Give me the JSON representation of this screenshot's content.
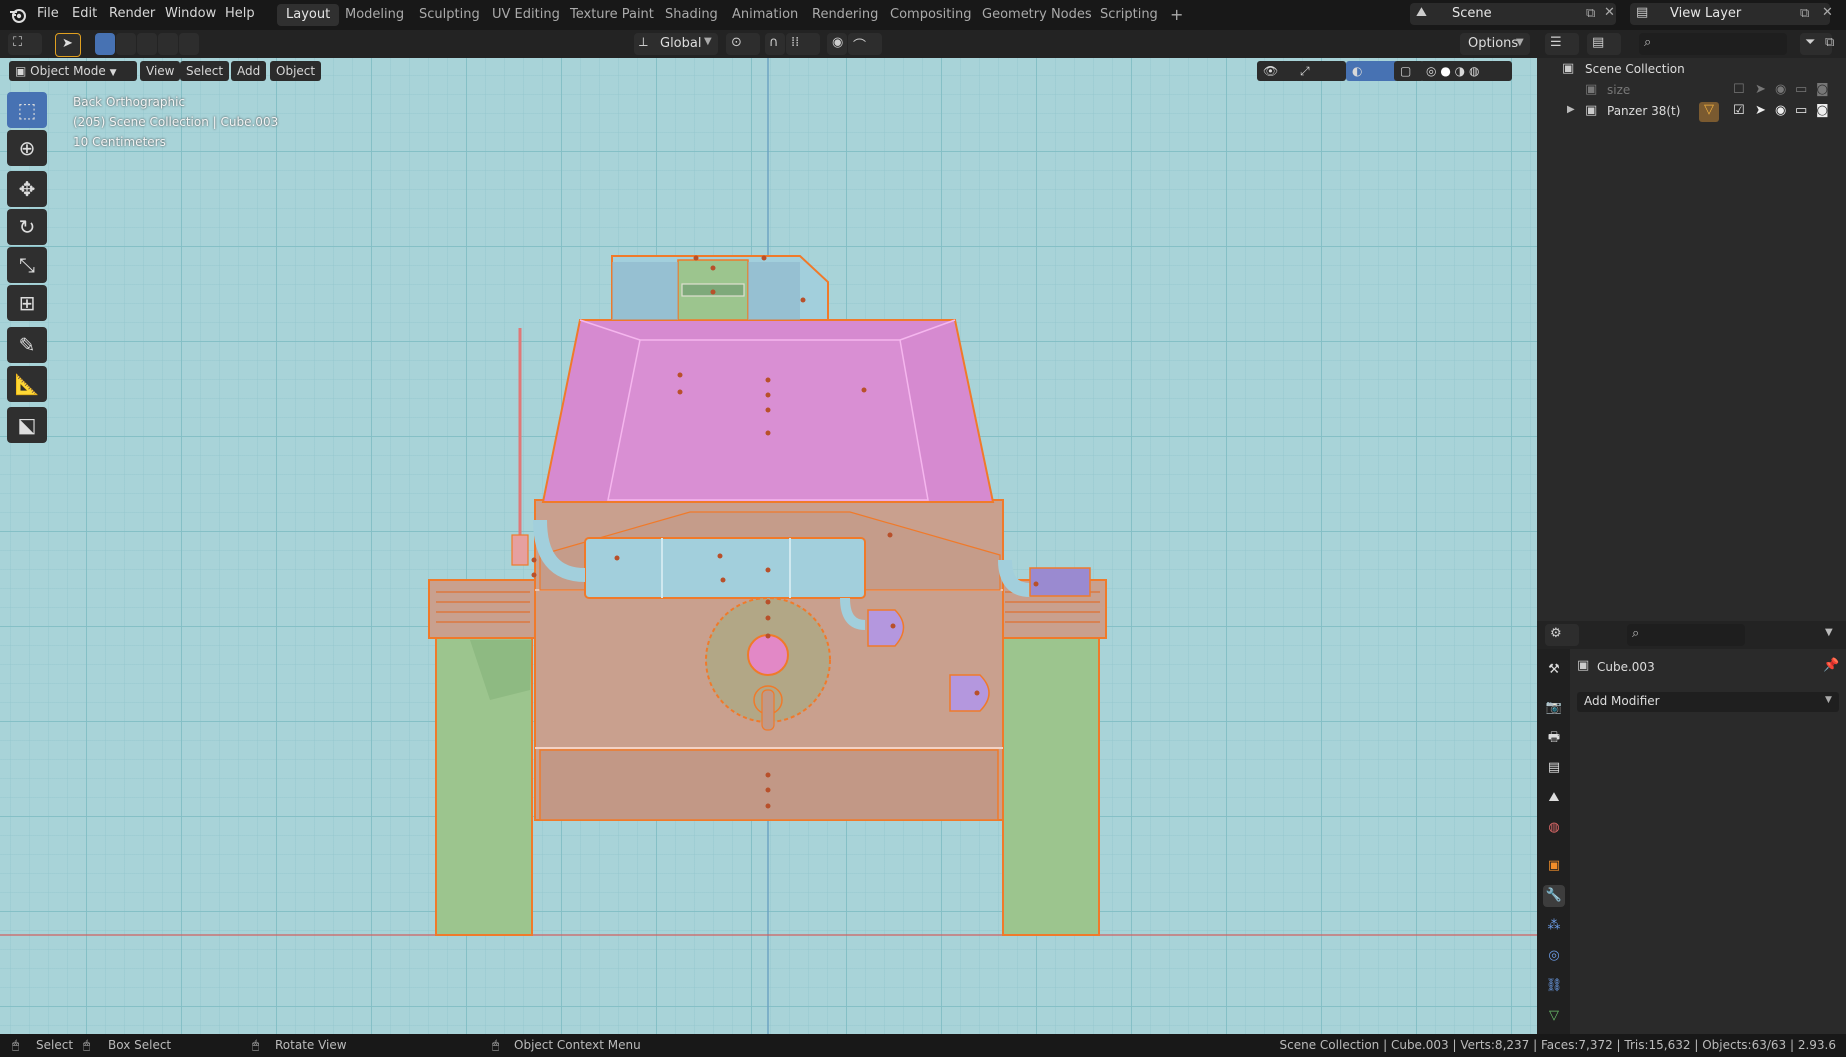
{
  "topbar": {
    "menus": [
      "File",
      "Edit",
      "Render",
      "Window",
      "Help"
    ],
    "workspaces": [
      "Layout",
      "Modeling",
      "Sculpting",
      "UV Editing",
      "Texture Paint",
      "Shading",
      "Animation",
      "Rendering",
      "Compositing",
      "Geometry Nodes",
      "Scripting"
    ],
    "active_workspace": "Layout",
    "add_workspace": "+",
    "scene": "Scene",
    "view_layer": "View Layer"
  },
  "header": {
    "transform_orientation": "Global",
    "options": "Options"
  },
  "viewport": {
    "mode": "Object Mode",
    "menus": [
      "View",
      "Select",
      "Add",
      "Object"
    ],
    "overlay_lines": [
      "Back Orthographic",
      "(205) Scene Collection | Cube.003",
      "10 Centimeters"
    ]
  },
  "outliner": {
    "root": "Scene Collection",
    "items": [
      {
        "label": "size",
        "dimmed": true
      },
      {
        "label": "Panzer 38(t)",
        "dimmed": false
      }
    ]
  },
  "properties": {
    "object_name": "Cube.003",
    "add_modifier": "Add Modifier"
  },
  "statusbar": {
    "select": "Select",
    "box_select": "Box Select",
    "rotate_view": "Rotate View",
    "context_menu": "Object Context Menu",
    "stats": "Scene Collection | Cube.003 | Verts:8,237 | Faces:7,372 | Tris:15,632 | Objects:63/63 | 2.93.6"
  },
  "colors": {
    "accent": "#4772b3",
    "viewport_bg": "#a8d3d8",
    "selection": "#ff7a1a",
    "turret": "#d68ad0",
    "hull": "#c9a08e",
    "tracks": "#9cc58e",
    "exhaust": "#a2cfdc"
  }
}
